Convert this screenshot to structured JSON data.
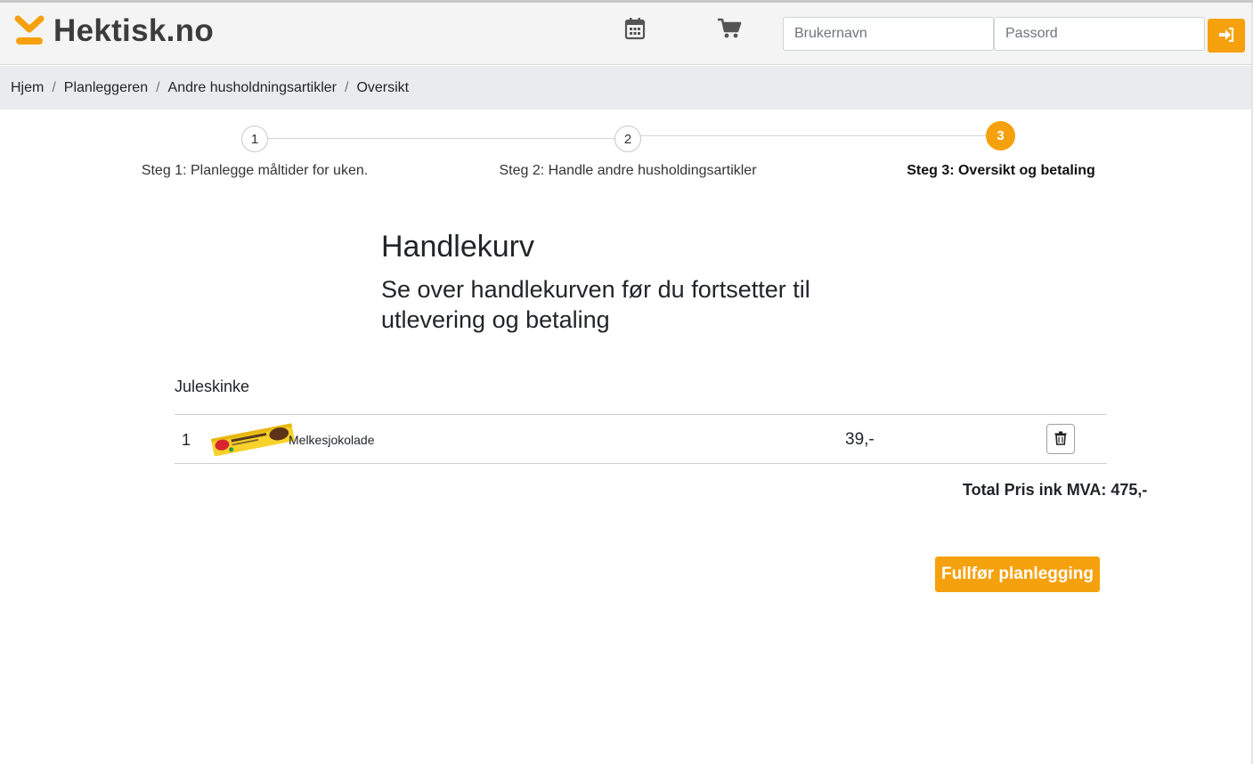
{
  "brand": {
    "name": "Hektisk.no",
    "accent": "#f5a10e"
  },
  "nav": {
    "calendar_icon": "calendar-icon",
    "cart_icon": "shopping-cart-icon",
    "username_placeholder": "Brukernavn",
    "password_placeholder": "Passord",
    "login_icon": "sign-in-icon"
  },
  "breadcrumb": [
    "Hjem",
    "Planleggeren",
    "Andre husholdningsartikler",
    "Oversikt"
  ],
  "steps": [
    {
      "number": "1",
      "label": "Steg 1: Planlegge måltider for uken."
    },
    {
      "number": "2",
      "label": "Steg 2: Handle andre husholdingsartikler"
    },
    {
      "number": "3",
      "label": "Steg 3: Oversikt og betaling",
      "active": true
    }
  ],
  "cart": {
    "title": "Handlekurv",
    "subtitle": "Se over handlekurven før du fortsetter til utlevering og betaling",
    "group": "Juleskinke",
    "items": [
      {
        "quantity": "1",
        "name": "Melkesjokolade",
        "price": "39,-",
        "delete_icon": "trash-icon"
      }
    ],
    "total": "Total Pris ink MVA: 475,-",
    "finish_label": "Fullfør planlegging"
  }
}
